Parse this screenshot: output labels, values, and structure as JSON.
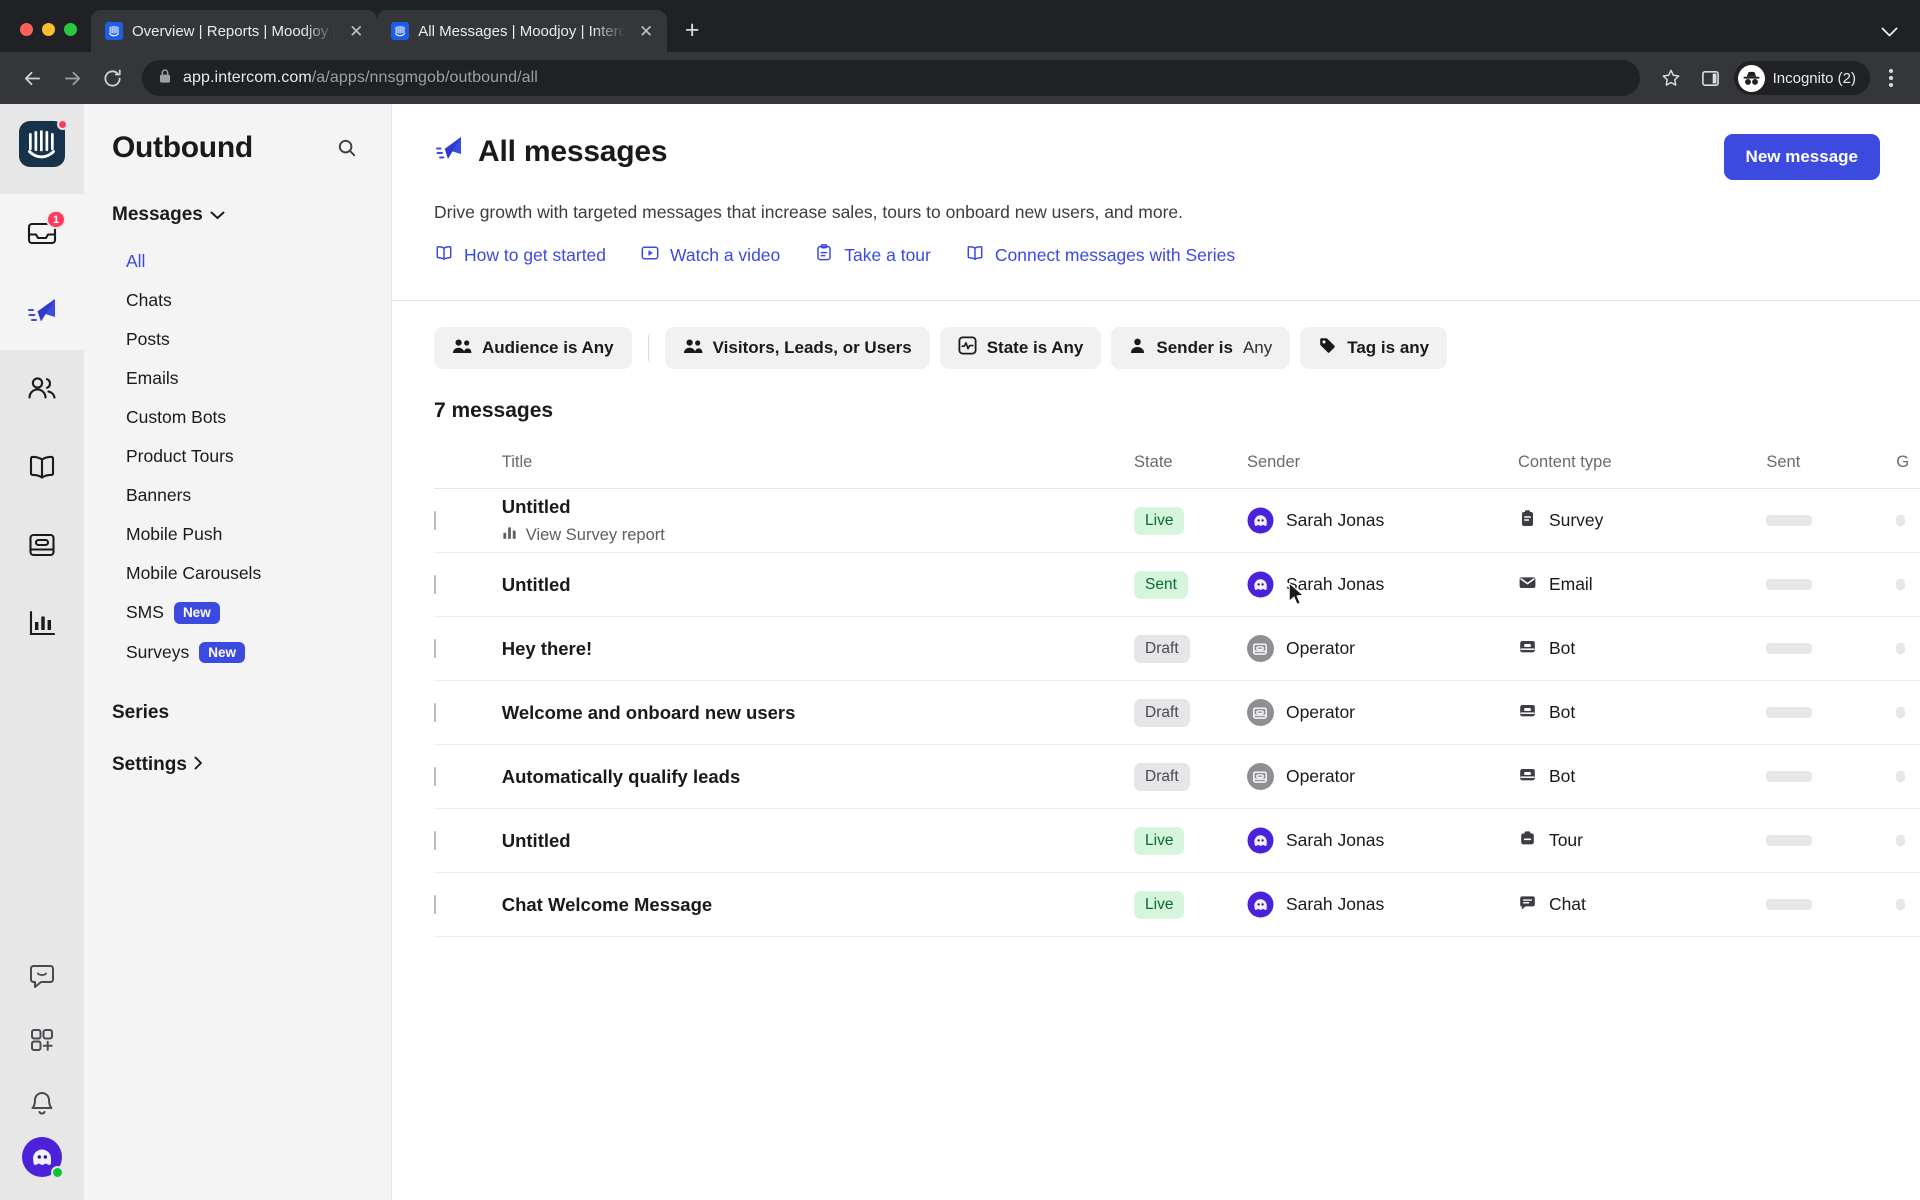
{
  "browser": {
    "tabs": [
      {
        "title": "Overview | Reports | Moodjoy |",
        "active": false,
        "close_label": "✕"
      },
      {
        "title": "All Messages | Moodjoy | Interc",
        "active": true,
        "close_label": "✕"
      }
    ],
    "new_tab_label": "+",
    "tab_list_chevron": "⌄",
    "url_host": "app.intercom.com",
    "url_path": "/a/apps/nnsgmgob/outbound/all",
    "profile_label": "Incognito (2)",
    "icons": {
      "back": "back-arrow-icon",
      "forward": "forward-arrow-icon",
      "reload": "reload-icon",
      "lock": "lock-icon",
      "bookmark": "star-icon",
      "side_panel": "side-panel-icon",
      "incognito": "incognito-icon",
      "menu": "kebab-menu-icon"
    }
  },
  "rail": {
    "logo_name": "intercom-logo",
    "items": [
      {
        "name": "inbox-icon",
        "badge": "1",
        "selected": true
      },
      {
        "name": "paper-plane-icon",
        "badge": "",
        "selected": true
      },
      {
        "name": "contacts-icon",
        "badge": "",
        "selected": false
      },
      {
        "name": "articles-icon",
        "badge": "",
        "selected": false
      },
      {
        "name": "bot-icon",
        "badge": "",
        "selected": false
      },
      {
        "name": "reports-icon",
        "badge": "",
        "selected": false
      }
    ],
    "bottom": [
      {
        "name": "messenger-icon"
      },
      {
        "name": "apps-add-icon"
      },
      {
        "name": "bell-icon"
      }
    ]
  },
  "sidebar": {
    "title": "Outbound",
    "search_icon": "search-icon",
    "messages_section": {
      "label": "Messages",
      "chevron": "⌄"
    },
    "items": [
      {
        "label": "All",
        "active": true,
        "badge": ""
      },
      {
        "label": "Chats",
        "active": false,
        "badge": ""
      },
      {
        "label": "Posts",
        "active": false,
        "badge": ""
      },
      {
        "label": "Emails",
        "active": false,
        "badge": ""
      },
      {
        "label": "Custom Bots",
        "active": false,
        "badge": ""
      },
      {
        "label": "Product Tours",
        "active": false,
        "badge": ""
      },
      {
        "label": "Banners",
        "active": false,
        "badge": ""
      },
      {
        "label": "Mobile Push",
        "active": false,
        "badge": ""
      },
      {
        "label": "Mobile Carousels",
        "active": false,
        "badge": ""
      },
      {
        "label": "SMS",
        "active": false,
        "badge": "New"
      },
      {
        "label": "Surveys",
        "active": false,
        "badge": "New"
      }
    ],
    "series_label": "Series",
    "settings_label": "Settings",
    "settings_chevron": "›"
  },
  "main": {
    "title": "All messages",
    "title_icon": "paper-plane-icon",
    "new_message_button": "New message",
    "subtitle": "Drive growth with targeted messages that increase sales, tours to onboard new users, and more.",
    "quicklinks": [
      {
        "label": "How to get started",
        "icon": "book-icon"
      },
      {
        "label": "Watch a video",
        "icon": "play-video-icon"
      },
      {
        "label": "Take a tour",
        "icon": "tour-clipboard-icon"
      },
      {
        "label": "Connect messages with Series",
        "icon": "book-icon"
      }
    ],
    "filters": [
      {
        "label": "Audience is Any",
        "value": "",
        "icon": "people-icon"
      },
      {
        "label": "Visitors, Leads, or Users",
        "value": "",
        "icon": "people-icon"
      },
      {
        "label": "State is Any",
        "value": "",
        "icon": "state-wave-icon"
      },
      {
        "label": "Sender is",
        "value": "Any",
        "icon": "person-icon"
      },
      {
        "label": "Tag is any",
        "value": "",
        "icon": "tag-icon"
      }
    ],
    "count_label": "7 messages",
    "columns": [
      "Title",
      "State",
      "Sender",
      "Content type",
      "Sent",
      "G"
    ],
    "rows": [
      {
        "title": "Untitled",
        "sub": "View Survey report",
        "sub_icon": "bar-chart-icon",
        "state": "Live",
        "state_kind": "live",
        "sender": "Sarah Jonas",
        "sender_kind": "user",
        "content_type": "Survey",
        "type_icon": "survey-icon"
      },
      {
        "title": "Untitled",
        "sub": "",
        "sub_icon": "",
        "state": "Sent",
        "state_kind": "sent",
        "sender": "Sarah Jonas",
        "sender_kind": "user",
        "content_type": "Email",
        "type_icon": "email-icon"
      },
      {
        "title": "Hey there!",
        "sub": "",
        "sub_icon": "",
        "state": "Draft",
        "state_kind": "draft",
        "sender": "Operator",
        "sender_kind": "operator",
        "content_type": "Bot",
        "type_icon": "bot-icon"
      },
      {
        "title": "Welcome and onboard new users",
        "sub": "",
        "sub_icon": "",
        "state": "Draft",
        "state_kind": "draft",
        "sender": "Operator",
        "sender_kind": "operator",
        "content_type": "Bot",
        "type_icon": "bot-icon"
      },
      {
        "title": "Automatically qualify leads",
        "sub": "",
        "sub_icon": "",
        "state": "Draft",
        "state_kind": "draft",
        "sender": "Operator",
        "sender_kind": "operator",
        "content_type": "Bot",
        "type_icon": "bot-icon"
      },
      {
        "title": "Untitled",
        "sub": "",
        "sub_icon": "",
        "state": "Live",
        "state_kind": "live",
        "sender": "Sarah Jonas",
        "sender_kind": "user",
        "content_type": "Tour",
        "type_icon": "tour-icon"
      },
      {
        "title": "Chat Welcome Message",
        "sub": "",
        "sub_icon": "",
        "state": "Live",
        "state_kind": "live",
        "sender": "Sarah Jonas",
        "sender_kind": "user",
        "content_type": "Chat",
        "type_icon": "chat-icon"
      }
    ]
  },
  "colors": {
    "accent": "#3c4ae0",
    "live_bg": "#d6f5dd",
    "live_fg": "#0b6b2c",
    "draft_bg": "#e6e6e8",
    "notif": "#ff3b5c"
  }
}
